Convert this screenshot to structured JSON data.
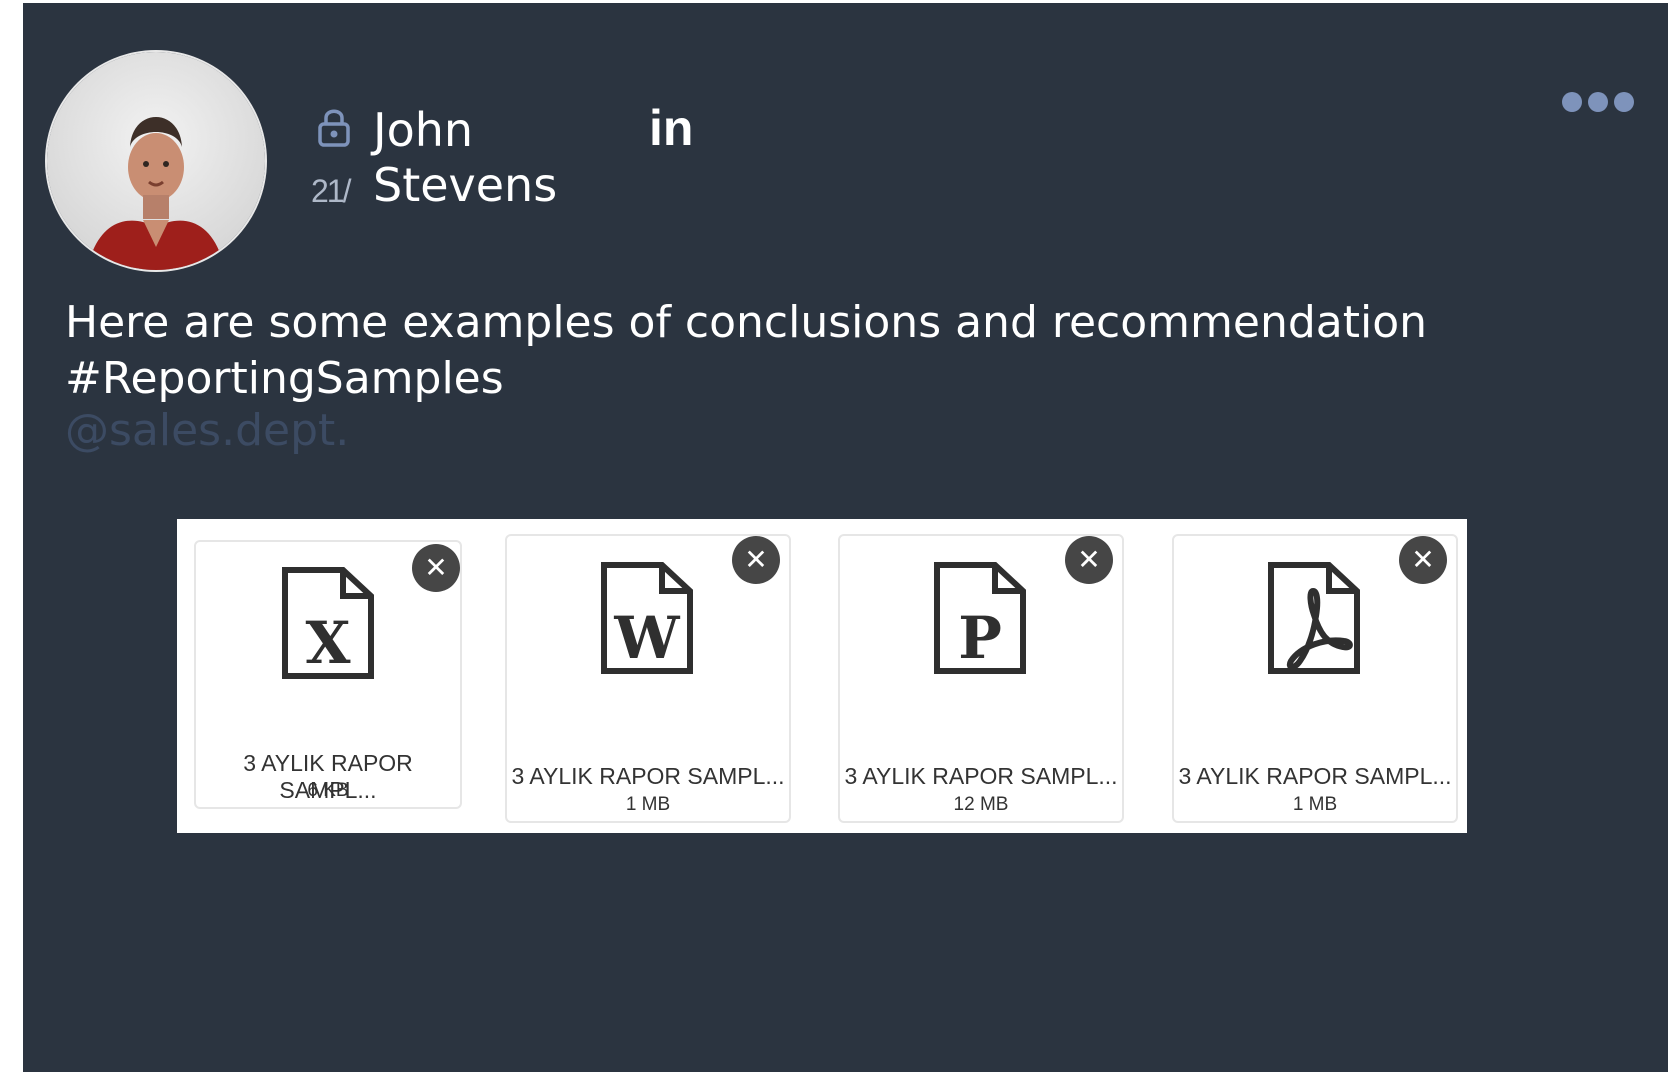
{
  "post": {
    "date": "21/",
    "first_name": "John",
    "last_name": "Stevens",
    "linkedin_label": "in",
    "message": "Here are some examples of conclusions and recommendation #ReportingSamples",
    "mention": "@sales.dept."
  },
  "icons": {
    "lock": "lock-icon",
    "more": "more-icon",
    "close": "close-icon"
  },
  "files": [
    {
      "letter": "X",
      "name": "3 AYLIK RAPOR SAMPL...",
      "size": "6 KB",
      "icon": "excel-icon"
    },
    {
      "letter": "W",
      "name": "3 AYLIK RAPOR SAMPL...",
      "size": "1 MB",
      "icon": "word-icon"
    },
    {
      "letter": "P",
      "name": "3 AYLIK RAPOR SAMPL...",
      "size": "12 MB",
      "icon": "powerpoint-icon"
    },
    {
      "letter": "",
      "name": "3 AYLIK RAPOR SAMPL...",
      "size": "1 MB",
      "icon": "pdf-icon"
    }
  ],
  "close_label": "✕"
}
